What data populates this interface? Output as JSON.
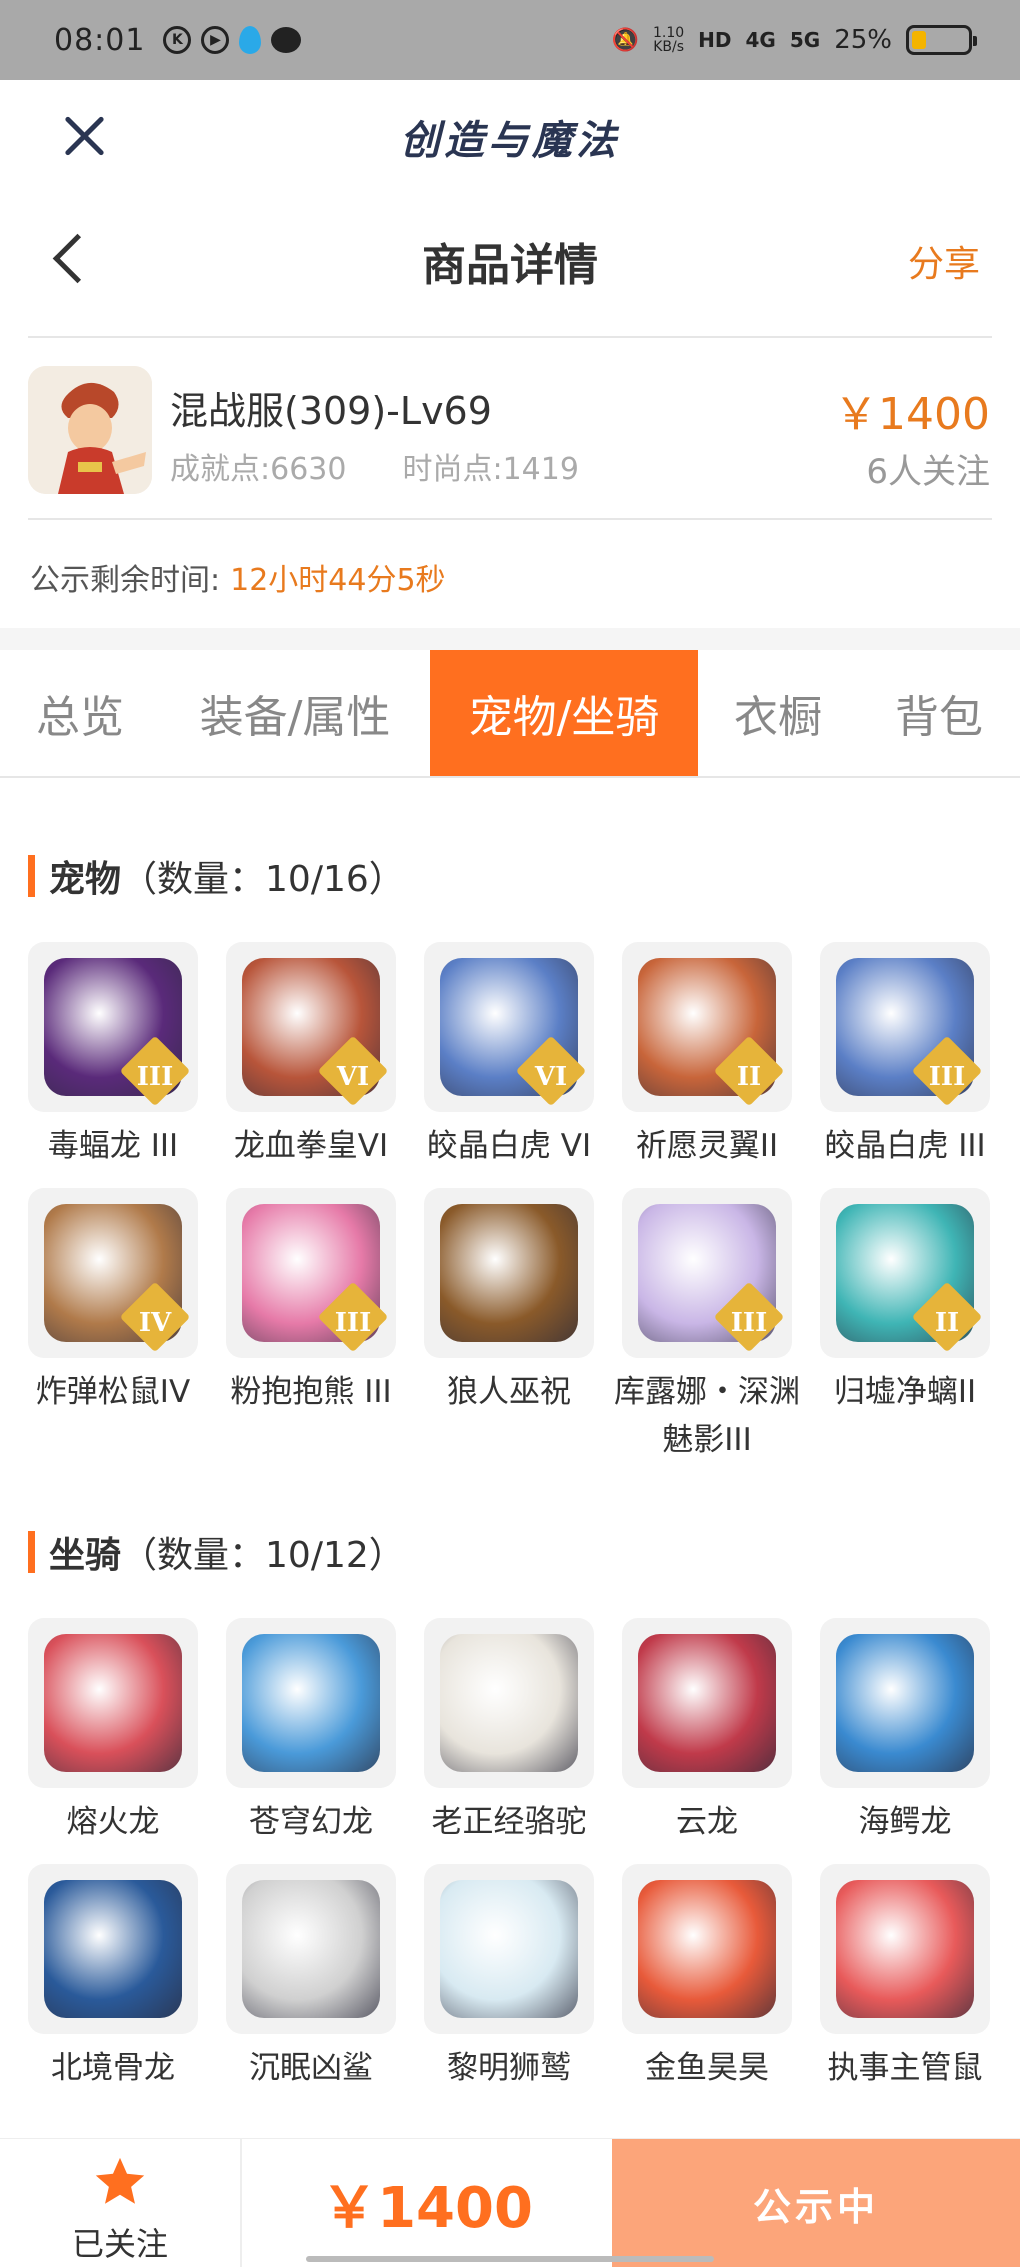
{
  "status_bar": {
    "time": "08:01",
    "speed_value": "1.10",
    "speed_unit": "KB/s",
    "hd_tag": "HD",
    "net1": "4G",
    "net2": "5G",
    "battery_pct": "25%",
    "battery_level": 0.25
  },
  "app": {
    "title": "创造与魔法"
  },
  "page": {
    "title": "商品详情",
    "share_label": "分享"
  },
  "product": {
    "name": "混战服(309)-Lv69",
    "achievement": "成就点:6630",
    "fashion": "时尚点:1419",
    "price": "￥1400",
    "followers": "6人关注"
  },
  "countdown": {
    "label": "公示剩余时间:",
    "value": "12小时44分5秒"
  },
  "tabs": [
    {
      "label": "总览"
    },
    {
      "label": "装备/属性"
    },
    {
      "label": "宠物/坐骑"
    },
    {
      "label": "衣橱"
    },
    {
      "label": "背包"
    }
  ],
  "pets": {
    "title": "宠物",
    "count": "（数量：10/16）",
    "items": [
      {
        "name": "毒蝠龙 III",
        "rank": "III",
        "color": "#5a2a7a"
      },
      {
        "name": "龙血拳皇VI",
        "rank": "VI",
        "color": "#b8553a"
      },
      {
        "name": "皎晶白虎 VI",
        "rank": "VI",
        "color": "#5b7fc6"
      },
      {
        "name": "祈愿灵翼II",
        "rank": "II",
        "color": "#c8653a"
      },
      {
        "name": "皎晶白虎 III",
        "rank": "III",
        "color": "#5b7fc6"
      },
      {
        "name": "炸弹松鼠IV",
        "rank": "IV",
        "color": "#b07a4a"
      },
      {
        "name": "粉抱抱熊 III",
        "rank": "III",
        "color": "#e67aa8"
      },
      {
        "name": "狼人巫祝",
        "rank": "",
        "color": "#8a5a2a"
      },
      {
        "name": "库露娜・深渊魅影III",
        "rank": "III",
        "color": "#c9b6e6"
      },
      {
        "name": "归墟净螭II",
        "rank": "II",
        "color": "#3fb5b5"
      }
    ]
  },
  "mounts": {
    "title": "坐骑",
    "count": "（数量：10/12）",
    "items": [
      {
        "name": "熔火龙",
        "color": "#d9505a"
      },
      {
        "name": "苍穹幻龙",
        "color": "#4a9ad9"
      },
      {
        "name": "老正经骆驼",
        "color": "#e8e4dc"
      },
      {
        "name": "云龙",
        "color": "#c03a4a"
      },
      {
        "name": "海鳄龙",
        "color": "#3a8ad0"
      },
      {
        "name": "北境骨龙",
        "color": "#2a5a9a"
      },
      {
        "name": "沉眠凶鲨",
        "color": "#d0d0d0"
      },
      {
        "name": "黎明狮鹫",
        "color": "#d8eaf2"
      },
      {
        "name": "金鱼昊昊",
        "color": "#e85a3a"
      },
      {
        "name": "执事主管鼠",
        "color": "#e85a5a"
      }
    ]
  },
  "bottom": {
    "follow_label": "已关注",
    "price": "￥1400",
    "status_label": "公示中"
  },
  "colors": {
    "accent": "#ff6f1f",
    "price": "#e87a1e",
    "status_bg": "#fca57a"
  }
}
